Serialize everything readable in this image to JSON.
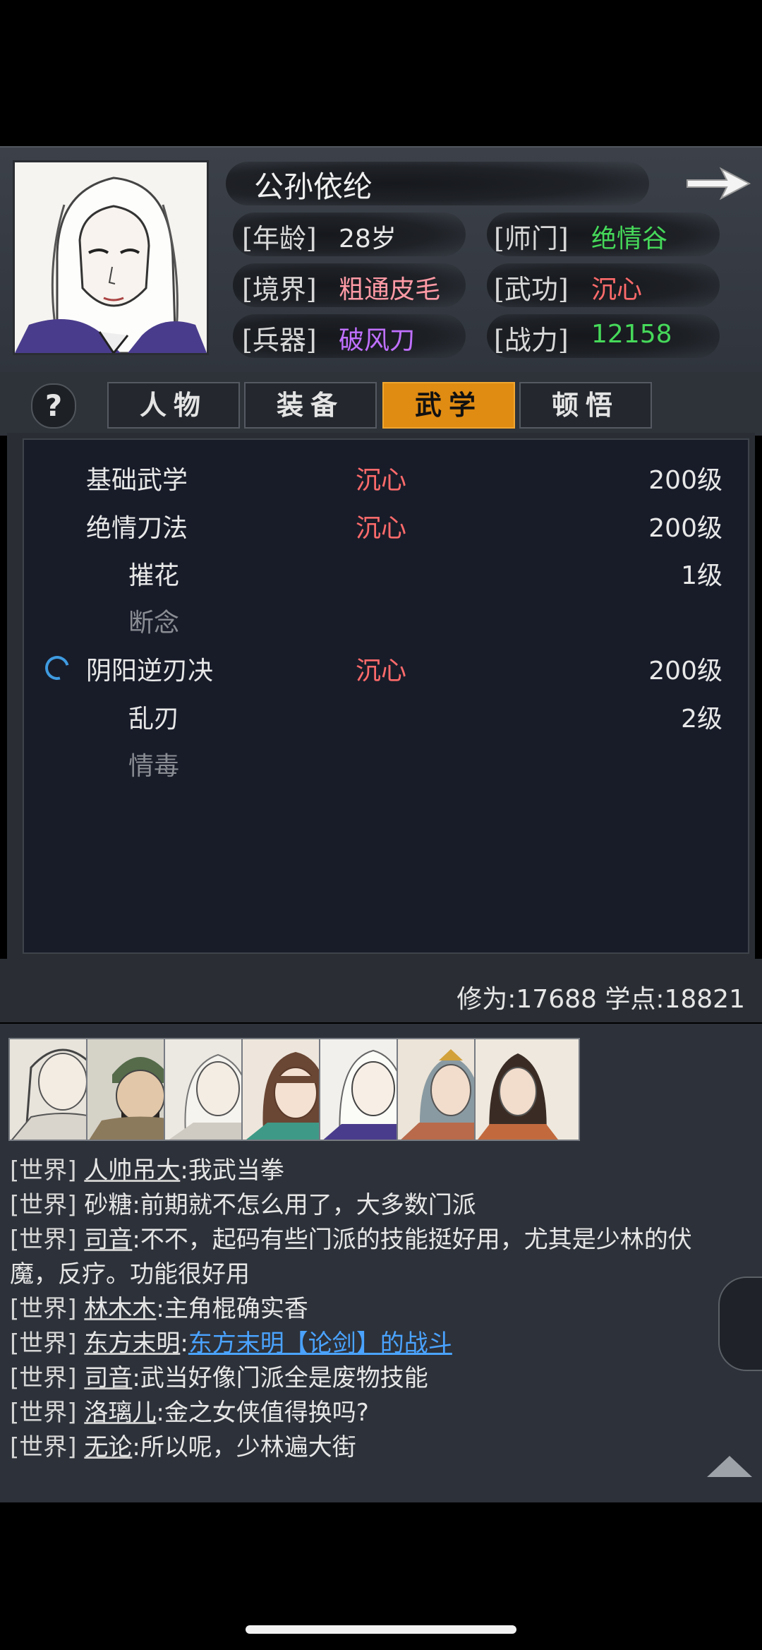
{
  "profile": {
    "name": "公孙依纶",
    "stats": [
      {
        "label": "[年龄]",
        "value": "28岁",
        "color": "#e8e8e8"
      },
      {
        "label": "[师门]",
        "value": "绝情谷",
        "color": "#46d95a"
      },
      {
        "label": "[境界]",
        "value": "粗通皮毛",
        "color": "#ff9aa5"
      },
      {
        "label": "[武功]",
        "value": "沉心",
        "color": "#ff6b6b"
      },
      {
        "label": "[兵器]",
        "value": "破风刀",
        "color": "#c070ff"
      },
      {
        "label": "[战力]",
        "value": "12158",
        "color": "#46d95a"
      }
    ]
  },
  "tabs": {
    "help": "?",
    "items": [
      "人物",
      "装备",
      "武学",
      "顿悟"
    ],
    "active_index": 2
  },
  "skills": [
    {
      "name": "基础武学",
      "state": "沉心",
      "level": "200级",
      "indent": 0,
      "dim": false
    },
    {
      "name": "绝情刀法",
      "state": "沉心",
      "level": "200级",
      "indent": 0,
      "dim": false
    },
    {
      "name": "摧花",
      "state": "",
      "level": "1级",
      "indent": 1,
      "dim": false
    },
    {
      "name": "断念",
      "state": "",
      "level": "",
      "indent": 1,
      "dim": true
    },
    {
      "name": "阴阳逆刃决",
      "state": "沉心",
      "level": "200级",
      "indent": 0,
      "dim": false,
      "spinner": true
    },
    {
      "name": "乱刃",
      "state": "",
      "level": "2级",
      "indent": 1,
      "dim": false
    },
    {
      "name": "情毒",
      "state": "",
      "level": "",
      "indent": 1,
      "dim": true
    }
  ],
  "points": "修为:17688 学点:18821",
  "chat": [
    {
      "channel": "[世界]",
      "user": "人帅吊大",
      "sep": ":",
      "text": "我武当拳"
    },
    {
      "channel": "[世界]",
      "user": "砂糖",
      "sep": ":",
      "text": "前期就不怎么用了，大多数门派"
    },
    {
      "channel": "[世界]",
      "user": "司音",
      "sep": ":",
      "text": "不不，起码有些门派的技能挺好用，尤其是少林的伏"
    },
    {
      "channel": "",
      "user": "",
      "sep": "",
      "text": "魔，反疗。功能很好用"
    },
    {
      "channel": "[世界]",
      "user": "林木木",
      "sep": ":",
      "text": "主角棍确实香"
    },
    {
      "channel": "[世界]",
      "user": "东方末明",
      "sep": ":",
      "text": "",
      "link": "东方末明【论剑】的战斗"
    },
    {
      "channel": "[世界]",
      "user": "司音",
      "sep": ":",
      "text": "武当好像门派全是废物技能"
    },
    {
      "channel": "[世界]",
      "user": "洛璃儿",
      "sep": ":",
      "text": "金之女侠值得换吗?"
    },
    {
      "channel": "[世界]",
      "user": "无论",
      "sep": ":",
      "text": "所以呢，少林遍大街"
    }
  ]
}
